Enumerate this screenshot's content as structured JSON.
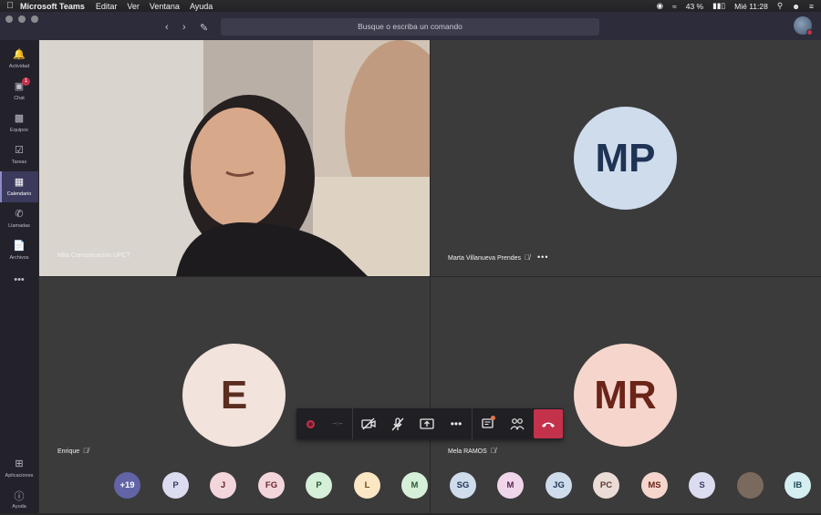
{
  "menubar": {
    "app_name": "Microsoft Teams",
    "menus": [
      "Editar",
      "Ver",
      "Ventana",
      "Ayuda"
    ],
    "battery": "43 %",
    "clock": "Mié 11:28"
  },
  "titlebar": {
    "search_placeholder": "Busque o escriba un comando"
  },
  "rail": {
    "items": [
      {
        "label": "Actividad",
        "icon": "bell-icon"
      },
      {
        "label": "Chat",
        "icon": "chat-icon",
        "badge": "1"
      },
      {
        "label": "Equipos",
        "icon": "teams-icon"
      },
      {
        "label": "Tareas",
        "icon": "tasks-icon"
      },
      {
        "label": "Calendario",
        "icon": "calendar-icon"
      },
      {
        "label": "Llamadas",
        "icon": "phone-icon"
      },
      {
        "label": "Archivos",
        "icon": "files-icon"
      }
    ],
    "more": "•••",
    "apps_label": "Aplicaciones",
    "help_label": "Ayuda"
  },
  "tiles": [
    {
      "name": "Mila Comunicación UPCT"
    },
    {
      "name": "Marta Villanueva Prendes",
      "initials": "MP",
      "bg": "#cfdcec",
      "fg": "#1f3355"
    },
    {
      "name": "Enrique",
      "initials": "E",
      "bg": "#f2e3dc",
      "fg": "#5a2e1f"
    },
    {
      "name": "Mela RAMOS",
      "initials": "MR",
      "bg": "#f6d6cc",
      "fg": "#6a2418"
    }
  ],
  "toolbar": {
    "timer": "--:--",
    "hangup_color": "#c4314b"
  },
  "participants": [
    {
      "initials": "+19",
      "bg": "#6264a7",
      "fg": "#ffffff"
    },
    {
      "initials": "P",
      "bg": "#dcdcf0",
      "fg": "#3a3a66"
    },
    {
      "initials": "J",
      "bg": "#f3d6dc",
      "fg": "#6a2430"
    },
    {
      "initials": "FG",
      "bg": "#f3d6dc",
      "fg": "#6a2430"
    },
    {
      "initials": "P",
      "bg": "#d6efd9",
      "fg": "#2b5a33"
    },
    {
      "initials": "L",
      "bg": "#fbe7c4",
      "fg": "#6a4a14"
    },
    {
      "initials": "M",
      "bg": "#d6efd9",
      "fg": "#2b5a33"
    },
    {
      "initials": "SG",
      "bg": "#cfdcec",
      "fg": "#1f3355"
    },
    {
      "initials": "M",
      "bg": "#f0d6ea",
      "fg": "#5a2450"
    },
    {
      "initials": "JG",
      "bg": "#cfdcec",
      "fg": "#1f3355"
    },
    {
      "initials": "PC",
      "bg": "#ecdcd6",
      "fg": "#5a3a2e"
    },
    {
      "initials": "MS",
      "bg": "#f6d6cc",
      "fg": "#6a2418"
    },
    {
      "initials": "S",
      "bg": "#dcdcf0",
      "fg": "#3a3a66"
    },
    {
      "initials": "",
      "bg": "#7a6a5e",
      "fg": "#ffffff"
    },
    {
      "initials": "IB",
      "bg": "#d4eef2",
      "fg": "#1f4a55"
    }
  ]
}
